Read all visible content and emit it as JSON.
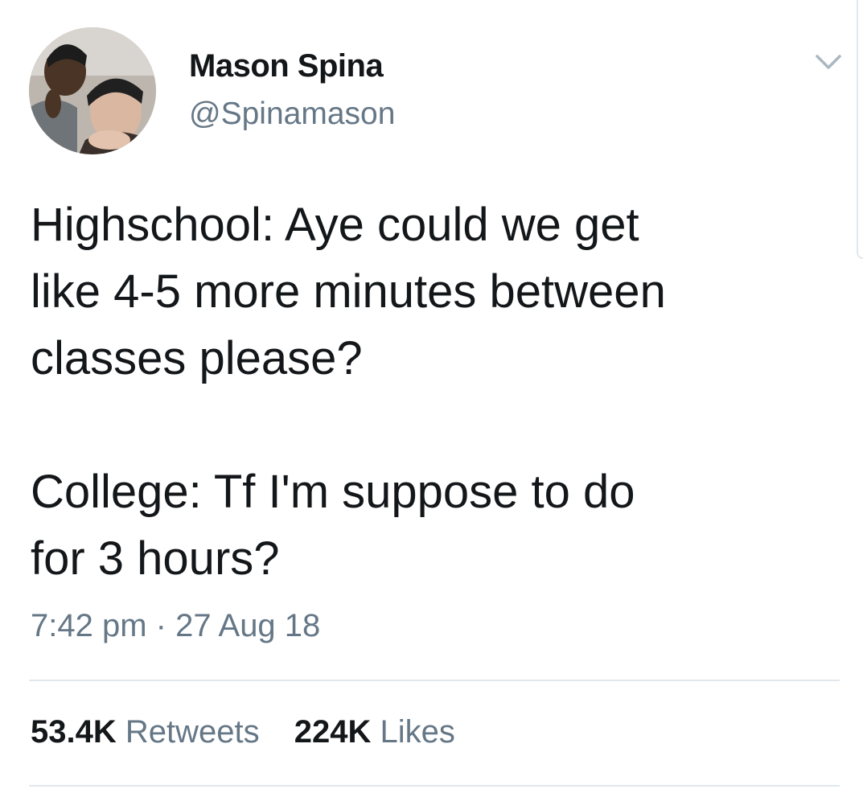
{
  "user": {
    "display_name": "Mason Spina",
    "handle": "@Spinamason",
    "avatar_icon": "profile-photo"
  },
  "tweet": {
    "lines": [
      "Highschool: Aye could we get",
      "like 4-5 more minutes between",
      "classes please?",
      "College: Tf I'm suppose to do",
      "for 3 hours?"
    ],
    "time": "7:42 pm",
    "separator": "·",
    "date": "27 Aug 18"
  },
  "stats": {
    "retweets_count": "53.4K",
    "retweets_label": "Retweets",
    "likes_count": "224K",
    "likes_label": "Likes"
  },
  "icons": {
    "menu": "chevron-down-icon"
  },
  "colors": {
    "text": "#14171a",
    "secondary": "#657786",
    "divider": "#e1e8ed",
    "background": "#ffffff"
  }
}
